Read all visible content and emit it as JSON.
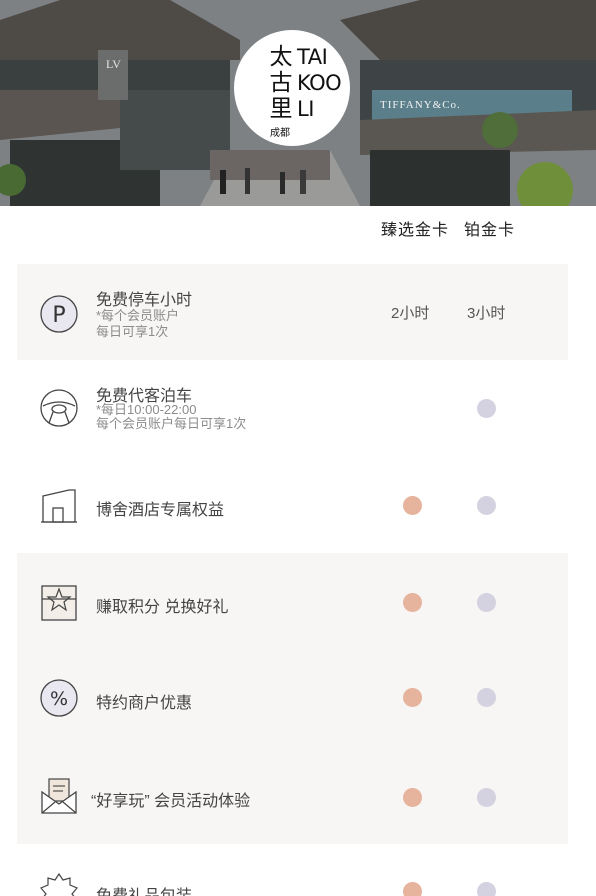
{
  "hero": {
    "logo_cn": "太古里",
    "logo_en_lines": [
      "TAI",
      "KOO",
      "LI"
    ],
    "logo_city": "成都",
    "store_sign": "TIFFANY&Co."
  },
  "tiers": {
    "gold": "臻选金卡",
    "platinum": "铂金卡"
  },
  "benefits": [
    {
      "icon": "parking-icon",
      "title": "免费停车小时",
      "notes": [
        "*每个会员账户",
        "每日可享1次"
      ],
      "gold": "2小时",
      "platinum": "3小时"
    },
    {
      "icon": "steering-wheel-icon",
      "title": "免费代客泊车",
      "notes": [
        "*每日10:00-22:00",
        "每个会员账户每日可享1次"
      ],
      "gold": null,
      "platinum": "included"
    },
    {
      "icon": "hotel-building-icon",
      "title": "博舍酒店专属权益",
      "notes": [],
      "gold": "included",
      "platinum": "included"
    },
    {
      "icon": "gift-box-icon",
      "title": "赚取积分 兑换好礼",
      "notes": [],
      "gold": "included",
      "platinum": "included"
    },
    {
      "icon": "percent-icon",
      "title": "特约商户优惠",
      "notes": [],
      "gold": "included",
      "platinum": "included"
    },
    {
      "icon": "envelope-icon",
      "title": "“好享玩” 会员活动体验",
      "notes": [],
      "gold": "included",
      "platinum": "included"
    },
    {
      "icon": "gift-wrap-icon",
      "title": "免费礼品包装",
      "notes": [],
      "gold": "included",
      "platinum": "included"
    }
  ],
  "colors": {
    "gold_dot": "#e6b39d",
    "platinum_dot": "#d4d2e0",
    "row_shade": "#f7f6f4"
  }
}
